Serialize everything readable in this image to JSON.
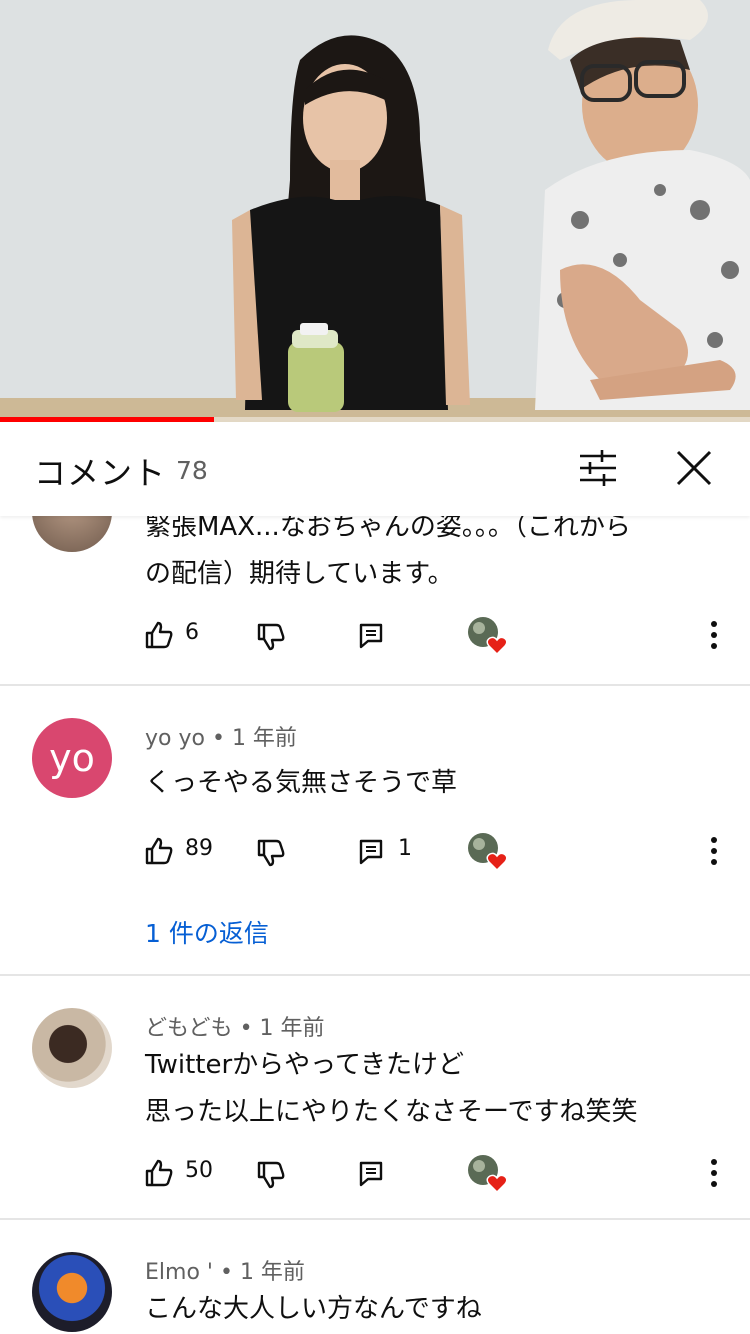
{
  "video": {
    "progress_fraction": 0.285,
    "progress_color": "#ff0000"
  },
  "comments_panel": {
    "title": "コメント",
    "count": "78",
    "filter_icon": "sliders-icon",
    "close_icon": "close-icon"
  },
  "comments": [
    {
      "author": "",
      "age": "",
      "lines": [
        "緊張MAX...なおちゃんの姿。。。（これから",
        "の配信）期待しています。"
      ],
      "likes": "6",
      "replies_count": "",
      "avatar_icon": "photo-avatar-icon",
      "replies_link": ""
    },
    {
      "author": "yo yo",
      "separator": "•",
      "age": "1 年前",
      "lines": [
        "くっそやる気無さそうで草"
      ],
      "likes": "89",
      "replies_count": "1",
      "avatar_letters": "yo",
      "avatar_color": "#d9476f",
      "replies_link": "1 件の返信"
    },
    {
      "author": "どもども",
      "separator": "•",
      "age": "1 年前",
      "lines": [
        "Twitterからやってきたけど",
        "思った以上にやりたくなさそーですね笑笑"
      ],
      "likes": "50",
      "replies_count": "",
      "avatar_icon": "photo-avatar-icon",
      "replies_link": ""
    },
    {
      "author": "Elmo '",
      "separator": "•",
      "age": "1 年前",
      "lines": [
        "こんな大人しい方なんですね"
      ],
      "avatar_icon": "squid-avatar-icon"
    }
  ],
  "icons": {
    "like": "thumbs-up-icon",
    "dislike": "thumbs-down-icon",
    "reply": "reply-icon",
    "creator_heart": "creator-heart-icon",
    "more": "more-vertical-icon"
  },
  "colors": {
    "link": "#065fd4",
    "heart": "#e62117",
    "divider": "#e5e5e5"
  }
}
